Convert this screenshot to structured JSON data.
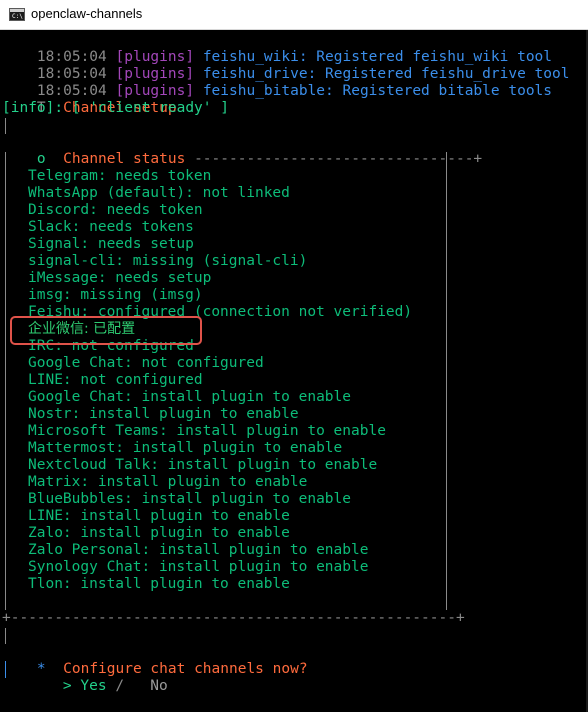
{
  "window": {
    "title": "openclaw-channels",
    "icon": "console-icon",
    "icon_text": "C:\\"
  },
  "log_lines": [
    {
      "time": "18:05:04",
      "tag": "[plugins]",
      "msg": "feishu_wiki: Registered feishu_wiki tool"
    },
    {
      "time": "18:05:04",
      "tag": "[plugins]",
      "msg": "feishu_drive: Registered feishu_drive tool"
    },
    {
      "time": "18:05:04",
      "tag": "[plugins]",
      "msg": "feishu_bitable: Registered bitable tools"
    }
  ],
  "setup": {
    "marker": "T",
    "title": "Channel setup"
  },
  "info_line": "[info]: [ 'client ready' ]",
  "status": {
    "marker": "o",
    "title": "Channel status",
    "rule": "--------------------------------+",
    "items": [
      "Telegram: needs token",
      "WhatsApp (default): not linked",
      "Discord: needs token",
      "Slack: needs tokens",
      "Signal: needs setup",
      "signal-cli: missing (signal-cli)",
      "iMessage: needs setup",
      "imsg: missing (imsg)",
      "Feishu: configured (connection not verified)",
      "企业微信: 已配置",
      "IRC: not configured",
      "Google Chat: not configured",
      "LINE: not configured",
      "Google Chat: install plugin to enable",
      "Nostr: install plugin to enable",
      "Microsoft Teams: install plugin to enable",
      "Mattermost: install plugin to enable",
      "Nextcloud Talk: install plugin to enable",
      "Matrix: install plugin to enable",
      "BlueBubbles: install plugin to enable",
      "LINE: install plugin to enable",
      "Zalo: install plugin to enable",
      "Zalo Personal: install plugin to enable",
      "Synology Chat: install plugin to enable",
      "Tlon: install plugin to enable"
    ],
    "bottom_rule": "+---------------------------------------------------+"
  },
  "prompt": {
    "marker": "*",
    "question": "Configure chat channels now?",
    "cursor": ">",
    "yes": "Yes",
    "separator": "/",
    "no": "No"
  },
  "colors": {
    "time": "#8a8a8a",
    "tag": "#a347ba",
    "message": "#3b8eea",
    "heading": "#ff6b3d",
    "item": "#0dbc79",
    "highlight_box": "#e0534a"
  }
}
